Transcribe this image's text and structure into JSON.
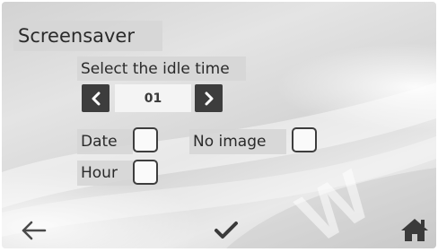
{
  "screen": {
    "title": "Screensaver"
  },
  "idle": {
    "label": "Select the idle time",
    "value": "01",
    "prev_icon": "chevron-left-icon",
    "next_icon": "chevron-right-icon"
  },
  "options": {
    "date_label": "Date",
    "date_checked": false,
    "no_image_label": "No image",
    "no_image_checked": false,
    "hour_label": "Hour",
    "hour_checked": false
  },
  "footer": {
    "back_icon": "arrow-left-icon",
    "confirm_icon": "checkmark-icon",
    "home_icon": "home-icon"
  },
  "colors": {
    "button_dark": "#3d3d3d",
    "label_bg": "#d6d6d6",
    "text": "#2a2a2a"
  }
}
